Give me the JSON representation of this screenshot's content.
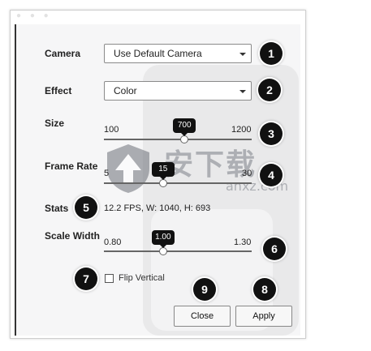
{
  "camera": {
    "label": "Camera",
    "value": "Use Default Camera"
  },
  "effect": {
    "label": "Effect",
    "value": "Color"
  },
  "size": {
    "label": "Size",
    "min": "100",
    "max": "1200",
    "value": "700",
    "fraction": 0.545
  },
  "frame_rate": {
    "label": "Frame Rate",
    "min": "5",
    "max": "30",
    "value": "15",
    "fraction": 0.4
  },
  "stats": {
    "label": "Stats",
    "value": "12.2 FPS, W: 1040, H: 693"
  },
  "scale_width": {
    "label": "Scale Width",
    "min": "0.80",
    "max": "1.30",
    "value": "1.00",
    "fraction": 0.4
  },
  "flip_vertical": {
    "label": "Flip Vertical",
    "checked": false
  },
  "buttons": {
    "close": "Close",
    "apply": "Apply"
  },
  "callouts": [
    "1",
    "2",
    "3",
    "4",
    "5",
    "6",
    "7",
    "8",
    "9"
  ],
  "watermark": {
    "text": "安下载",
    "subtext": "anxz.com"
  },
  "colors": {
    "callout_bg": "#111111",
    "tooltip_bg": "#111111",
    "dialog_bg": "#f6f6f7"
  }
}
